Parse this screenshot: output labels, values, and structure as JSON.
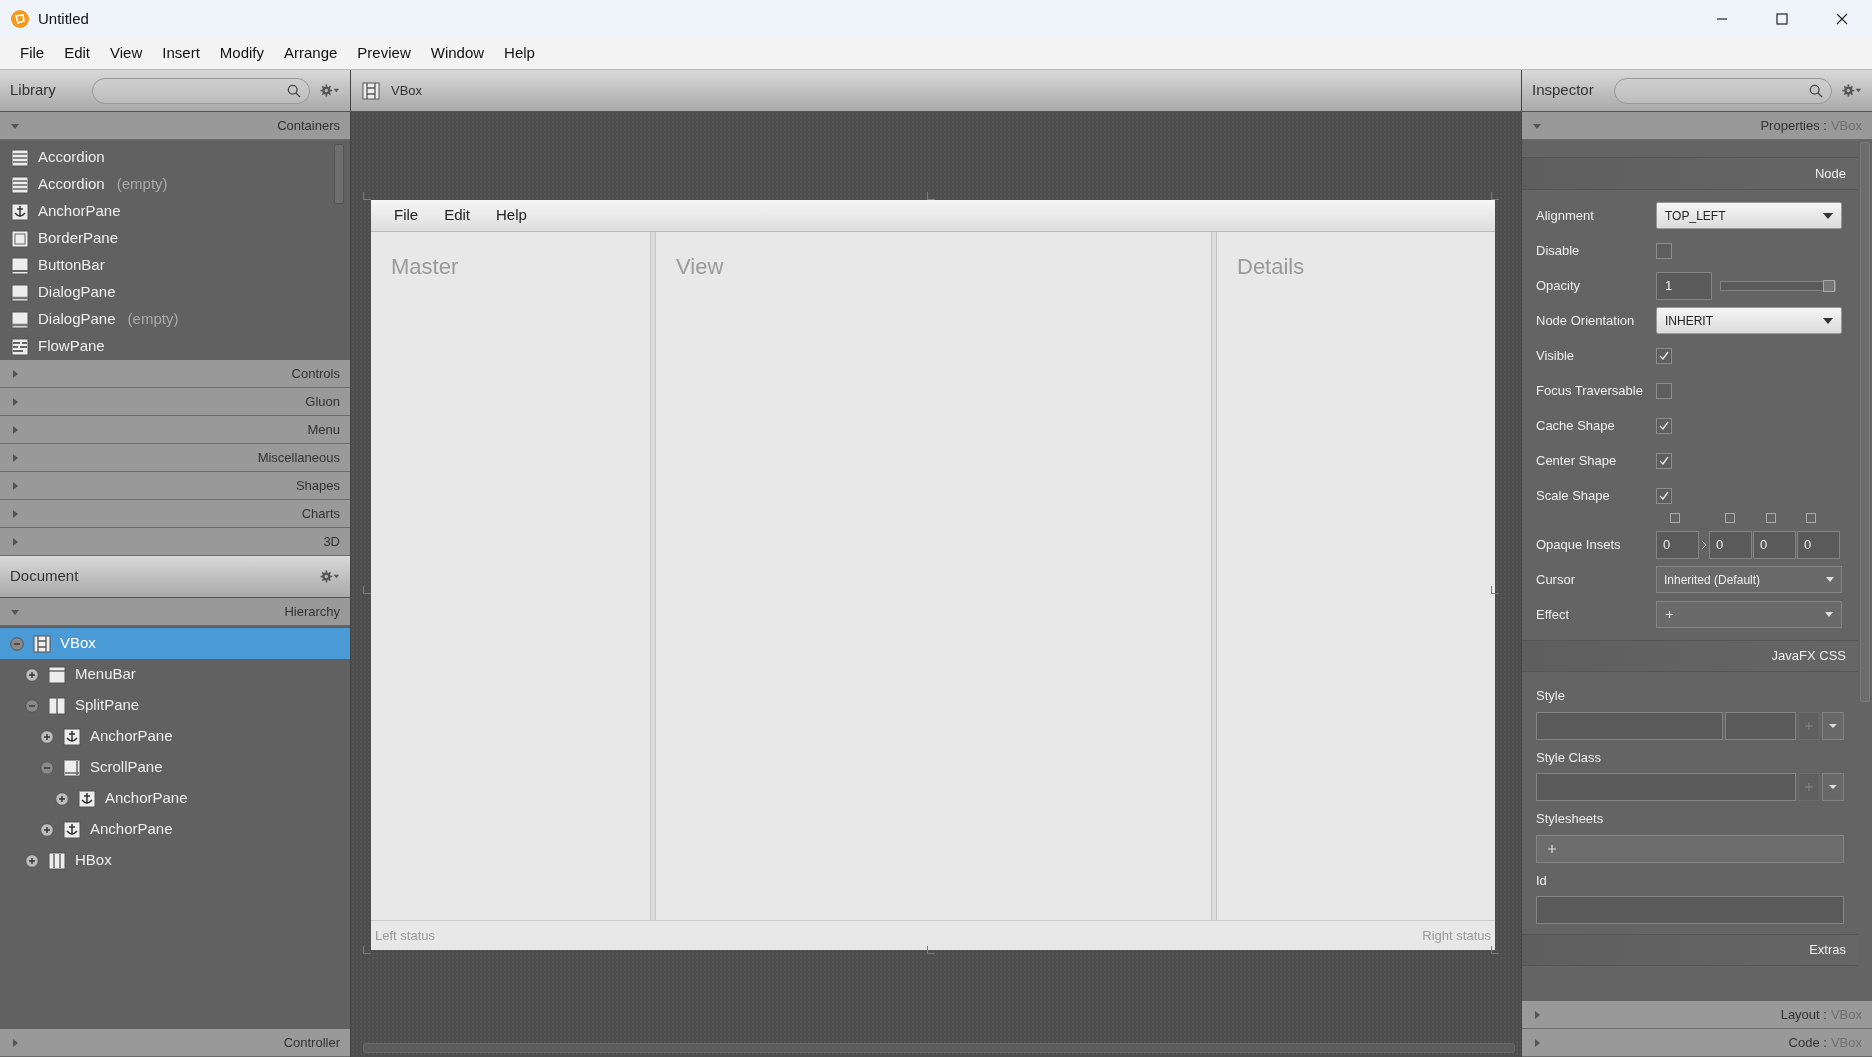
{
  "window": {
    "title": "Untitled"
  },
  "menu": [
    "File",
    "Edit",
    "View",
    "Insert",
    "Modify",
    "Arrange",
    "Preview",
    "Window",
    "Help"
  ],
  "library": {
    "title": "Library",
    "sections": [
      {
        "label": "Containers",
        "expanded": true,
        "items": [
          {
            "label": "Accordion",
            "kind": "accordion"
          },
          {
            "label": "Accordion",
            "note": "(empty)",
            "kind": "accordion"
          },
          {
            "label": "AnchorPane",
            "kind": "anchor"
          },
          {
            "label": "BorderPane",
            "kind": "border"
          },
          {
            "label": "ButtonBar",
            "kind": "buttonbar"
          },
          {
            "label": "DialogPane",
            "kind": "dialog"
          },
          {
            "label": "DialogPane",
            "note": "(empty)",
            "kind": "dialog"
          },
          {
            "label": "FlowPane",
            "kind": "flow"
          }
        ]
      },
      {
        "label": "Controls",
        "expanded": false
      },
      {
        "label": "Gluon",
        "expanded": false
      },
      {
        "label": "Menu",
        "expanded": false
      },
      {
        "label": "Miscellaneous",
        "expanded": false
      },
      {
        "label": "Shapes",
        "expanded": false
      },
      {
        "label": "Charts",
        "expanded": false
      },
      {
        "label": "3D",
        "expanded": false
      }
    ]
  },
  "canvas": {
    "breadcrumb": "VBox",
    "preview": {
      "menu": [
        "File",
        "Edit",
        "Help"
      ],
      "panes": [
        "Master",
        "View",
        "Details"
      ],
      "status_left": "Left status",
      "status_right": "Right status"
    }
  },
  "document": {
    "title": "Document",
    "sections": [
      {
        "label": "Hierarchy",
        "expanded": true
      },
      {
        "label": "Controller",
        "expanded": false
      }
    ],
    "tree": [
      {
        "label": "VBox",
        "kind": "vbox",
        "expanded": true,
        "selected": true,
        "children": [
          {
            "label": "MenuBar",
            "kind": "menubar",
            "expanded": false,
            "selected": false
          },
          {
            "label": "SplitPane",
            "kind": "splitpane",
            "expanded": true,
            "selected": false,
            "children": [
              {
                "label": "AnchorPane",
                "kind": "anchor",
                "expanded": false,
                "selected": false
              },
              {
                "label": "ScrollPane",
                "kind": "scrollpane",
                "expanded": true,
                "selected": false,
                "children": [
                  {
                    "label": "AnchorPane",
                    "kind": "anchor",
                    "expanded": false,
                    "selected": false
                  }
                ]
              },
              {
                "label": "AnchorPane",
                "kind": "anchor",
                "expanded": false,
                "selected": false
              }
            ]
          },
          {
            "label": "HBox",
            "kind": "hbox",
            "expanded": false,
            "selected": false
          }
        ]
      }
    ]
  },
  "inspector": {
    "title": "Inspector",
    "sections": [
      {
        "label": "Properties :",
        "target": "VBox",
        "expanded": true
      },
      {
        "label": "Layout :",
        "target": "VBox",
        "expanded": false
      },
      {
        "label": "Code :",
        "target": "VBox",
        "expanded": false
      }
    ],
    "groups": [
      {
        "title": "Node",
        "rows": [
          {
            "label": "Alignment",
            "kind": "select",
            "value": "TOP_LEFT"
          },
          {
            "label": "Disable",
            "kind": "checkbox",
            "checked": false
          },
          {
            "label": "Opacity",
            "kind": "slider",
            "value": "1",
            "level": 1
          },
          {
            "label": "Node Orientation",
            "kind": "select",
            "value": "INHERIT"
          },
          {
            "label": "Visible",
            "kind": "checkbox",
            "checked": true
          },
          {
            "label": "Focus Traversable",
            "kind": "checkbox",
            "checked": false
          },
          {
            "label": "Cache Shape",
            "kind": "checkbox",
            "checked": true
          },
          {
            "label": "Center Shape",
            "kind": "checkbox",
            "checked": true
          },
          {
            "label": "Scale Shape",
            "kind": "checkbox",
            "checked": true
          },
          {
            "label": "Opaque Insets",
            "kind": "insets",
            "values": [
              "0",
              "0",
              "0",
              "0"
            ]
          },
          {
            "label": "Cursor",
            "kind": "combo",
            "value": "Inherited (Default)"
          },
          {
            "label": "Effect",
            "kind": "add_combo"
          }
        ]
      },
      {
        "title": "JavaFX CSS",
        "rows": [
          {
            "label": "Style",
            "kind": "style"
          },
          {
            "label": "Style Class",
            "kind": "style_class"
          },
          {
            "label": "Stylesheets",
            "kind": "add_list"
          },
          {
            "label": "Id",
            "kind": "text"
          }
        ]
      },
      {
        "title": "Extras"
      }
    ]
  }
}
